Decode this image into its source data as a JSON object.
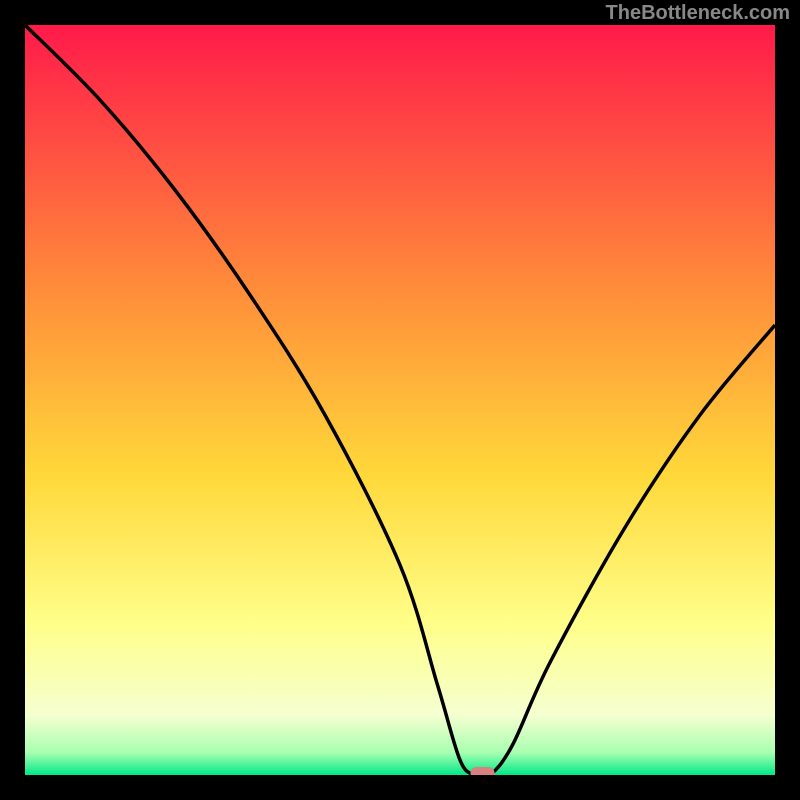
{
  "watermark": "TheBottleneck.com",
  "chart_data": {
    "type": "line",
    "title": "",
    "xlabel": "",
    "ylabel": "",
    "xlim": [
      0,
      100
    ],
    "ylim": [
      0,
      100
    ],
    "gradient_stops": [
      {
        "offset": 0,
        "color": "#ff1a4a"
      },
      {
        "offset": 0.35,
        "color": "#ff8c3a"
      },
      {
        "offset": 0.6,
        "color": "#ffd83a"
      },
      {
        "offset": 0.8,
        "color": "#ffff8a"
      },
      {
        "offset": 0.92,
        "color": "#f5ffd0"
      },
      {
        "offset": 0.97,
        "color": "#a8ffb0"
      },
      {
        "offset": 1.0,
        "color": "#00e888"
      }
    ],
    "series": [
      {
        "name": "bottleneck-curve",
        "x": [
          0,
          10,
          20,
          30,
          40,
          50,
          55,
          58,
          60,
          62,
          65,
          70,
          80,
          90,
          100
        ],
        "values": [
          100,
          90,
          78,
          64,
          48,
          28,
          12,
          2,
          0,
          0,
          4,
          15,
          33,
          48,
          60
        ]
      }
    ],
    "marker": {
      "x": 61,
      "y": 0,
      "color": "#d98080"
    }
  }
}
